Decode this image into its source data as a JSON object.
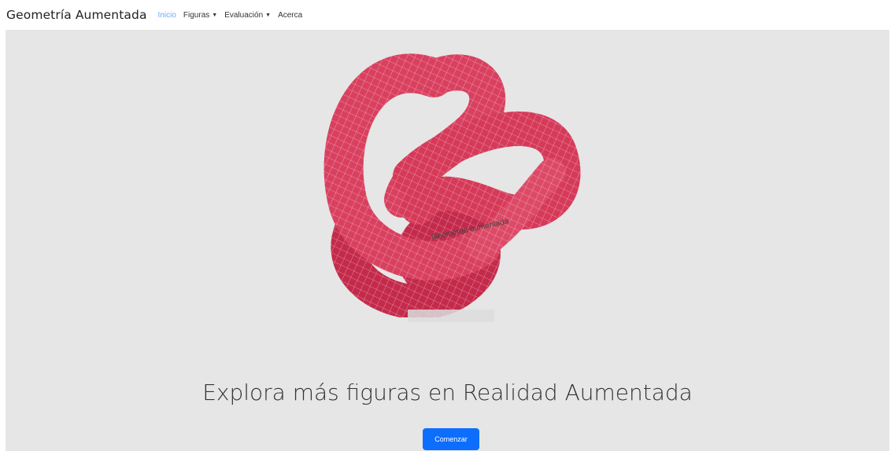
{
  "navbar": {
    "brand": "Geometría Aumentada",
    "items": [
      {
        "label": "Inicio",
        "active": true,
        "dropdown": false
      },
      {
        "label": "Figuras",
        "active": false,
        "dropdown": true
      },
      {
        "label": "Evaluación",
        "active": false,
        "dropdown": true
      },
      {
        "label": "Acerca",
        "active": false,
        "dropdown": false
      }
    ]
  },
  "hero": {
    "model_label": "Geometría aumentada",
    "headline": "Explora más figuras en Realidad Aumentada",
    "cta_label": "Comenzar"
  },
  "colors": {
    "knot": "#d9405f",
    "knot_dark": "#c42a4b",
    "hero_bg": "#e6e6e6",
    "accent": "#0d6efd",
    "active_nav": "#6ea8fe"
  },
  "icons": {
    "dropdown": "caret-down-icon"
  }
}
